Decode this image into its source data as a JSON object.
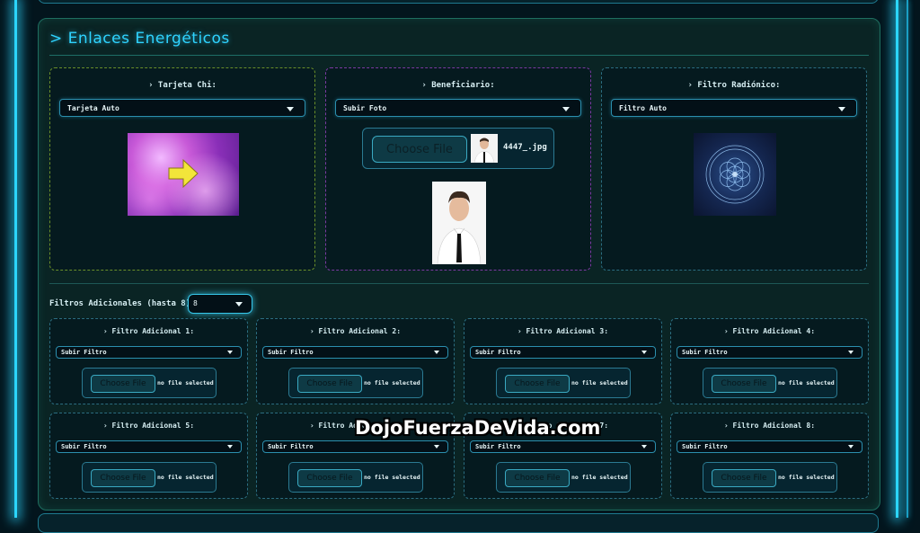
{
  "section": {
    "title": "> Enlaces Energéticos"
  },
  "cards": [
    {
      "title": "› Tarjeta Chi:",
      "select_value": "Tarjeta Auto"
    },
    {
      "title": "› Beneficiario:",
      "select_value": "Subir Foto",
      "choose_label": "Choose File",
      "file_name": "4447_.jpg"
    },
    {
      "title": "› Filtro Radiónico:",
      "select_value": "Filtro Auto"
    }
  ],
  "additional": {
    "label": "Filtros Adicionales (hasta 8):",
    "count_value": "8",
    "filters": [
      {
        "title": "› Filtro Adicional 1:",
        "select_value": "Subir Filtro",
        "choose_label": "Choose File",
        "file_status": "no file selected"
      },
      {
        "title": "› Filtro Adicional 2:",
        "select_value": "Subir Filtro",
        "choose_label": "Choose File",
        "file_status": "no file selected"
      },
      {
        "title": "› Filtro Adicional 3:",
        "select_value": "Subir Filtro",
        "choose_label": "Choose File",
        "file_status": "no file selected"
      },
      {
        "title": "› Filtro Adicional 4:",
        "select_value": "Subir Filtro",
        "choose_label": "Choose File",
        "file_status": "no file selected"
      },
      {
        "title": "› Filtro Adicional 5:",
        "select_value": "Subir Filtro",
        "choose_label": "Choose File",
        "file_status": "no file selected"
      },
      {
        "title": "› Filtro Adicional 6:",
        "select_value": "Subir Filtro",
        "choose_label": "Choose File",
        "file_status": "no file selected"
      },
      {
        "title": "› Filtro Adicional 7:",
        "select_value": "Subir Filtro",
        "choose_label": "Choose File",
        "file_status": "no file selected"
      },
      {
        "title": "› Filtro Adicional 8:",
        "select_value": "Subir Filtro",
        "choose_label": "Choose File",
        "file_status": "no file selected"
      }
    ]
  },
  "watermark": "DojoFuerzaDeVida.com",
  "colors": {
    "accent": "#2fd3ff",
    "panel": "#0a2424",
    "chi_border": "#6a8f2a",
    "beneficiary_border": "#7a3aa0"
  }
}
